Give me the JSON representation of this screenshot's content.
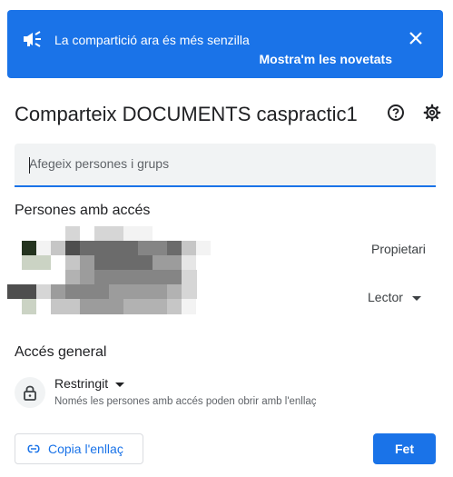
{
  "banner": {
    "message": "La compartició ara és més senzilla",
    "action_label": "Mostra'm les novetats",
    "icon": "megaphone-icon",
    "close_icon": "close-icon",
    "background": "#1a73e8"
  },
  "dialog": {
    "title": "Comparteix DOCUMENTS caspractic1",
    "help_icon": "help-icon",
    "settings_icon": "gear-icon"
  },
  "add_people": {
    "placeholder": "Afegeix persones i grups",
    "value": ""
  },
  "people_section": {
    "heading": "Persones amb accés",
    "members": [
      {
        "role": "Propietari",
        "has_dropdown": false
      },
      {
        "role": "Lector",
        "has_dropdown": true
      }
    ]
  },
  "general_access": {
    "heading": "Accés general",
    "level": "Restringit",
    "description": "Només les persones amb accés poden obrir amb l'enllaç",
    "icon": "lock-icon"
  },
  "footer": {
    "copy_link_label": "Copia l'enllaç",
    "copy_icon": "link-icon",
    "done_label": "Fet"
  },
  "colors": {
    "accent": "#1a73e8",
    "text": "#202124",
    "muted": "#5f6368"
  }
}
